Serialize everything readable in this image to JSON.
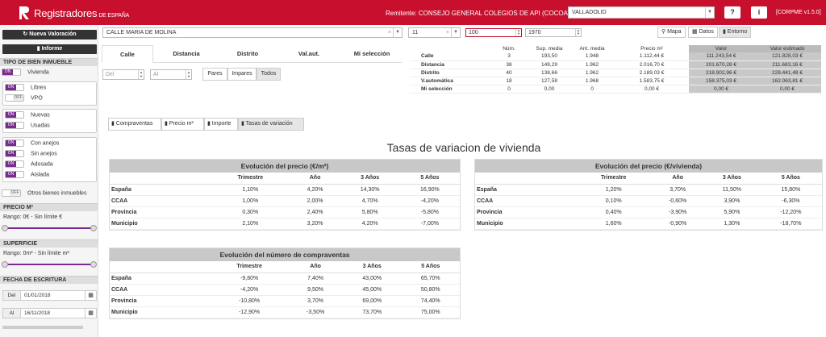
{
  "header": {
    "brand": "Registradores",
    "brand_suffix": "DE ESPAÑA",
    "remitente": "Remitente: CONSEJO GENERAL COLEGIOS DE API (COCOAPI) ▾",
    "city": "VALLADOLID",
    "version": "CORPME v1.5.0",
    "help_icon": "question-icon",
    "info_icon": "info-icon"
  },
  "sidebar": {
    "new_valuation": "Nueva Valoración",
    "report": "Informe",
    "tipo_bien_title": "TIPO DE BIEN INMUEBLE",
    "vivienda": "Vivienda",
    "libres": "Libres",
    "vpo": "VPO",
    "nuevas": "Nuevas",
    "usadas": "Usadas",
    "con_anejos": "Con anejos",
    "sin_anejos": "Sin anejos",
    "adosada": "Adosada",
    "aislada": "Aislada",
    "otros": "Otros bienes inmuebles",
    "on": "ON",
    "off": "OFF",
    "precio_title": "PRECIO M²",
    "precio_range": "Rango: 0€ - Sin límite €",
    "superficie_title": "SUPERFICIE",
    "superficie_range": "Rango: 0m² - Sin límite m²",
    "fecha_title": "FECHA DE ESCRITURA",
    "del_label": "Del",
    "del_value": "01/01/2018",
    "al_label": "Al",
    "al_value": "16/11/2018"
  },
  "search": {
    "street": "CALLE MARIA DE MOLINA",
    "number": "11",
    "radius": "100",
    "year": "1970",
    "mapa": "Mapa",
    "datos": "Datos",
    "entorno": "Entorno"
  },
  "tabs": [
    "Calle",
    "Distancia",
    "Distrito",
    "Val.aut.",
    "Mi selección"
  ],
  "filters": {
    "del_placeholder": "Del",
    "al_placeholder": "Al",
    "pares": "Pares",
    "impares": "Impares",
    "todos": "Todos"
  },
  "stats": {
    "headers": [
      "Núm.",
      "Sup. media",
      "Ant. media",
      "Precio m²",
      "Valor",
      "Valor estimado"
    ],
    "rows": [
      [
        "Calle",
        "3",
        "193,50",
        "1.948",
        "1.112,44 €",
        "111.243,54 €",
        "121.828,03 €"
      ],
      [
        "Distancia",
        "38",
        "149,29",
        "1.962",
        "2.016,70 €",
        "201.670,28 €",
        "211.683,16 €"
      ],
      [
        "Distrito",
        "40",
        "138,66",
        "1.962",
        "2.189,03 €",
        "218.902,96 €",
        "228.441,48 €"
      ],
      [
        "V.automática",
        "18",
        "127,58",
        "1.968",
        "1.583,75 €",
        "158.375,03 €",
        "162.063,81 €"
      ],
      [
        "Mi selección",
        "0",
        "0,00",
        "0",
        "0,00 €",
        "0,00 €",
        "0,00 €"
      ]
    ]
  },
  "subtabs": [
    "Compraventas",
    "Precio m²",
    "Importe",
    "Tasas de variación"
  ],
  "page_title": "Tasas de variacion de vivienda",
  "cards": {
    "precio_m2": {
      "title": "Evolución del precio (€/m²)",
      "headers": [
        "",
        "Trimestre",
        "Año",
        "3 Años",
        "5 Años"
      ],
      "rows": [
        [
          "España",
          "1,10%",
          "4,20%",
          "14,30%",
          "16,90%"
        ],
        [
          "CCAA",
          "1,00%",
          "2,00%",
          "4,70%",
          "-4,20%"
        ],
        [
          "Provincia",
          "0,30%",
          "2,40%",
          "5,80%",
          "-5,80%"
        ],
        [
          "Municipio",
          "2,10%",
          "3,20%",
          "4,20%",
          "-7,00%"
        ]
      ]
    },
    "precio_viv": {
      "title": "Evolución del precio (€/vivienda)",
      "headers": [
        "",
        "Trimestre",
        "Año",
        "3 Años",
        "5 Años"
      ],
      "rows": [
        [
          "España",
          "1,20%",
          "3,70%",
          "11,50%",
          "15,80%"
        ],
        [
          "CCAA",
          "0,10%",
          "-0,60%",
          "3,90%",
          "-6,30%"
        ],
        [
          "Provincia",
          "0,40%",
          "-3,90%",
          "5,90%",
          "-12,20%"
        ],
        [
          "Municipio",
          "1,60%",
          "-0,90%",
          "1,30%",
          "-18,70%"
        ]
      ]
    },
    "compraventas": {
      "title": "Evolución del número de compraventas",
      "headers": [
        "",
        "Trimestre",
        "Año",
        "3 Años",
        "5 Años"
      ],
      "rows": [
        [
          "España",
          "-9,80%",
          "7,40%",
          "43,00%",
          "65,70%"
        ],
        [
          "CCAA",
          "-4,20%",
          "9,50%",
          "45,00%",
          "50,80%"
        ],
        [
          "Provincia",
          "-10,80%",
          "3,70%",
          "69,00%",
          "74,40%"
        ],
        [
          "Municipio",
          "-12,90%",
          "-3,50%",
          "73,70%",
          "75,00%"
        ]
      ]
    }
  },
  "colors": {
    "brand_red": "#c8102e",
    "toggle_purple": "#7a2b8f",
    "header_grey": "#c8c8c8"
  }
}
